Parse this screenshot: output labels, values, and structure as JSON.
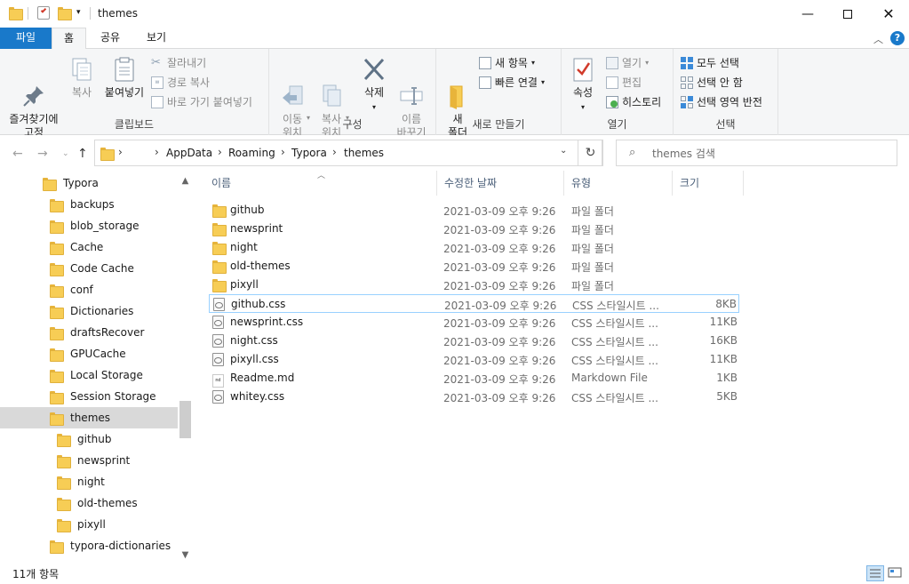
{
  "window": {
    "title": "themes"
  },
  "ribbon_tabs": [
    {
      "label": "파일"
    },
    {
      "label": "홈"
    },
    {
      "label": "공유"
    },
    {
      "label": "보기"
    }
  ],
  "ribbon": {
    "clipboard": {
      "label": "클립보드",
      "pin": "즐겨찾기에\n고정",
      "copy": "복사",
      "paste": "붙여넣기",
      "cut": "잘라내기",
      "copy_path": "경로 복사",
      "paste_shortcut": "바로 가기 붙여넣기"
    },
    "organize": {
      "label": "구성",
      "move_to": "이동\n위치",
      "copy_to": "복사\n위치",
      "delete": "삭제",
      "rename": "이름\n바꾸기"
    },
    "new": {
      "label": "새로 만들기",
      "new_folder": "새\n폴더",
      "new_item": "새 항목",
      "easy_access": "빠른 연결"
    },
    "open": {
      "label": "열기",
      "properties": "속성",
      "open": "열기",
      "edit": "편집",
      "history": "히스토리"
    },
    "select": {
      "label": "선택",
      "select_all": "모두 선택",
      "select_none": "선택 안 함",
      "invert": "선택 영역 반전"
    }
  },
  "address": {
    "crumbs": [
      "AppData",
      "Roaming",
      "Typora",
      "themes"
    ],
    "search_placeholder": "themes 검색"
  },
  "nav_tree": [
    {
      "label": "Typora",
      "level": 0
    },
    {
      "label": "backups",
      "level": 1
    },
    {
      "label": "blob_storage",
      "level": 1
    },
    {
      "label": "Cache",
      "level": 1
    },
    {
      "label": "Code Cache",
      "level": 1
    },
    {
      "label": "conf",
      "level": 1
    },
    {
      "label": "Dictionaries",
      "level": 1
    },
    {
      "label": "draftsRecover",
      "level": 1
    },
    {
      "label": "GPUCache",
      "level": 1
    },
    {
      "label": "Local Storage",
      "level": 1
    },
    {
      "label": "Session Storage",
      "level": 1
    },
    {
      "label": "themes",
      "level": 1,
      "selected": true
    },
    {
      "label": "github",
      "level": 2
    },
    {
      "label": "newsprint",
      "level": 2
    },
    {
      "label": "night",
      "level": 2
    },
    {
      "label": "old-themes",
      "level": 2
    },
    {
      "label": "pixyll",
      "level": 2
    },
    {
      "label": "typora-dictionaries",
      "level": 1
    }
  ],
  "columns": {
    "name": "이름",
    "date": "수정한 날짜",
    "type": "유형",
    "size": "크기"
  },
  "files": [
    {
      "name": "github",
      "date": "2021-03-09 오후 9:26",
      "type": "파일 폴더",
      "size": "",
      "icon": "folder"
    },
    {
      "name": "newsprint",
      "date": "2021-03-09 오후 9:26",
      "type": "파일 폴더",
      "size": "",
      "icon": "folder"
    },
    {
      "name": "night",
      "date": "2021-03-09 오후 9:26",
      "type": "파일 폴더",
      "size": "",
      "icon": "folder"
    },
    {
      "name": "old-themes",
      "date": "2021-03-09 오후 9:26",
      "type": "파일 폴더",
      "size": "",
      "icon": "folder"
    },
    {
      "name": "pixyll",
      "date": "2021-03-09 오후 9:26",
      "type": "파일 폴더",
      "size": "",
      "icon": "folder"
    },
    {
      "name": "github.css",
      "date": "2021-03-09 오후 9:26",
      "type": "CSS 스타일시트 ...",
      "size": "8KB",
      "icon": "css",
      "focused": true
    },
    {
      "name": "newsprint.css",
      "date": "2021-03-09 오후 9:26",
      "type": "CSS 스타일시트 ...",
      "size": "11KB",
      "icon": "css"
    },
    {
      "name": "night.css",
      "date": "2021-03-09 오후 9:26",
      "type": "CSS 스타일시트 ...",
      "size": "16KB",
      "icon": "css"
    },
    {
      "name": "pixyll.css",
      "date": "2021-03-09 오후 9:26",
      "type": "CSS 스타일시트 ...",
      "size": "11KB",
      "icon": "css"
    },
    {
      "name": "Readme.md",
      "date": "2021-03-09 오후 9:26",
      "type": "Markdown File",
      "size": "1KB",
      "icon": "md"
    },
    {
      "name": "whitey.css",
      "date": "2021-03-09 오후 9:26",
      "type": "CSS 스타일시트 ...",
      "size": "5KB",
      "icon": "css"
    }
  ],
  "status": {
    "item_count": "11개 항목"
  },
  "colors": {
    "accent": "#1979ca",
    "folder": "#f7cd55",
    "selection": "#d9d9d9",
    "focus_border": "#99d1ff"
  }
}
